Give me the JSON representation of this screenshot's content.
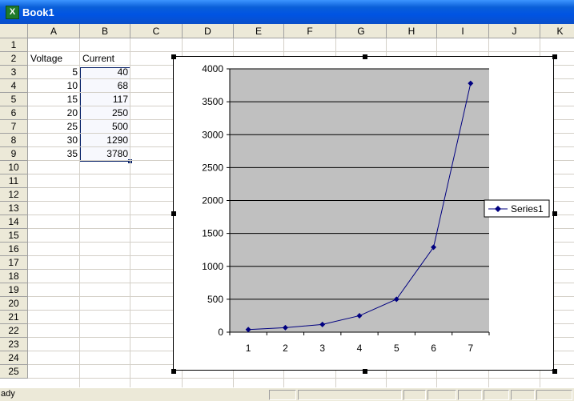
{
  "window": {
    "title": "Book1",
    "app_icon": "excel-icon"
  },
  "columns": [
    "A",
    "B",
    "C",
    "D",
    "E",
    "F",
    "G",
    "H",
    "I",
    "J",
    "K"
  ],
  "rows": [
    "1",
    "2",
    "3",
    "4",
    "5",
    "6",
    "7",
    "8",
    "9",
    "10",
    "11",
    "12",
    "13",
    "14",
    "15",
    "16",
    "17",
    "18",
    "19",
    "20",
    "21",
    "22",
    "23",
    "24",
    "25"
  ],
  "cells": {
    "A2": "Voltage",
    "B2": "Current",
    "A3": "5",
    "B3": "40",
    "A4": "10",
    "B4": "68",
    "A5": "15",
    "B5": "117",
    "A6": "20",
    "B6": "250",
    "A7": "25",
    "B7": "500",
    "A8": "30",
    "B8": "1290",
    "A9": "35",
    "B9": "3780"
  },
  "status": {
    "text": "ady"
  },
  "chart_data": {
    "type": "line",
    "categories": [
      "1",
      "2",
      "3",
      "4",
      "5",
      "6",
      "7"
    ],
    "series": [
      {
        "name": "Series1",
        "values": [
          40,
          68,
          117,
          250,
          500,
          1290,
          3780
        ]
      }
    ],
    "ylim": [
      0,
      4000
    ],
    "yticks": [
      "0",
      "500",
      "1000",
      "1500",
      "2000",
      "2500",
      "3000",
      "3500",
      "4000"
    ],
    "grid": true,
    "legend_position": "right",
    "plot_area_color": "#c0c0c0",
    "series_color": "#000080"
  }
}
